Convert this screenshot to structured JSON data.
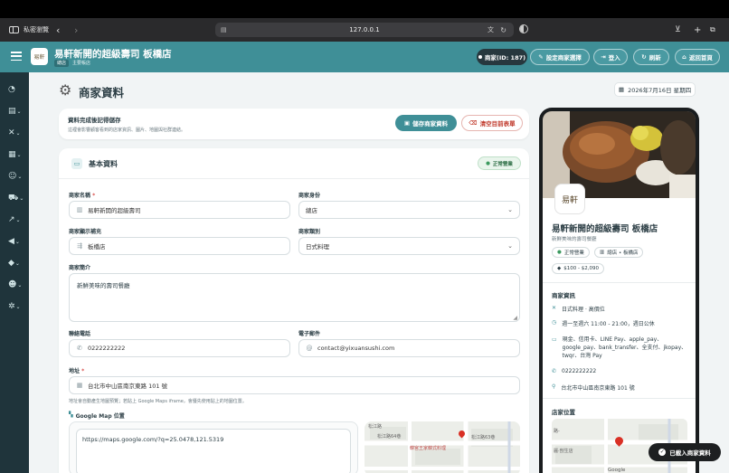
{
  "browser": {
    "private_label": "私密瀏覽",
    "url": "127.0.0.1"
  },
  "header": {
    "shop_name": "易軒新開的超級壽司 板橋店",
    "badge_branch": "總店",
    "badge_role": "主要帳店",
    "merchant_id": "商家(ID: 187)",
    "set_merchant_label": "設定商家選擇",
    "login_label": "登入",
    "refresh_label": "刷新",
    "home_label": "返回首頁"
  },
  "page": {
    "title": "商家資料",
    "date": "2026年7月16日 星期四"
  },
  "notice": {
    "title": "資料完成後記得儲存",
    "desc": "這裡會影響顧客看到的店家資訊、圖片、地圖與社群連結。",
    "save_label": "儲存商家資料",
    "clear_label": "清空目前表單"
  },
  "basic": {
    "section_title": "基本資料",
    "status": "正常營業",
    "name_label": "商家名稱",
    "name_value": "易軒新開的超級壽司",
    "identity_label": "商家身份",
    "identity_value": "總店",
    "display_suffix_label": "商家顯示補充",
    "display_suffix_value": "板橋店",
    "category_label": "商家類別",
    "category_value": "日式料理",
    "intro_label": "商家簡介",
    "intro_value": "新鮮美味的壽司餐廳",
    "phone_label": "聯絡電話",
    "phone_value": "0222222222",
    "email_label": "電子郵件",
    "email_value": "contact@yixuansushi.com",
    "address_label": "地址",
    "address_value": "台北市中山區南京東路 101 號",
    "address_hint": "地址會自動產生地圖預覽；若貼上 Google Maps iframe，會優先使用貼上的地圖位置。",
    "map_label": "Google Map 位置",
    "map_value": "https://maps.google.com/?q=25.0478,121.5319",
    "map_streets": [
      "松江路",
      "松江路64巷",
      "韓宮王家韓式料理",
      "松江路63巷"
    ]
  },
  "preview": {
    "logo_text": "易軒",
    "shop_name": "易軒新開的超級壽司 板橋店",
    "intro": "新鮮美味的壽司餐廳",
    "status_chip": "正常營業",
    "branch_chip": "總店 • 板橋店",
    "price_chip": "$100 - $2,090",
    "info_title": "商家資訊",
    "category": "日式料理 · 高價位",
    "hours": "週一至週六 11:00 - 21:00，週日公休",
    "payments": "現金、信用卡、LINE Pay、apple_pay、google_pay、bank_transfer、全支付、jkopay、twqr、台灣 Pay",
    "phone": "0222222222",
    "address": "台北市中山區南京東路 101 號",
    "location_title": "店家位置",
    "map_labels": [
      "路-",
      "麗·剖生店",
      "Google"
    ]
  },
  "toast": "已載入商家資料",
  "colors": {
    "brand": "#3f8f97",
    "sidebar": "#1f343b",
    "success": "#3c9a5f",
    "danger": "#d9534f"
  }
}
